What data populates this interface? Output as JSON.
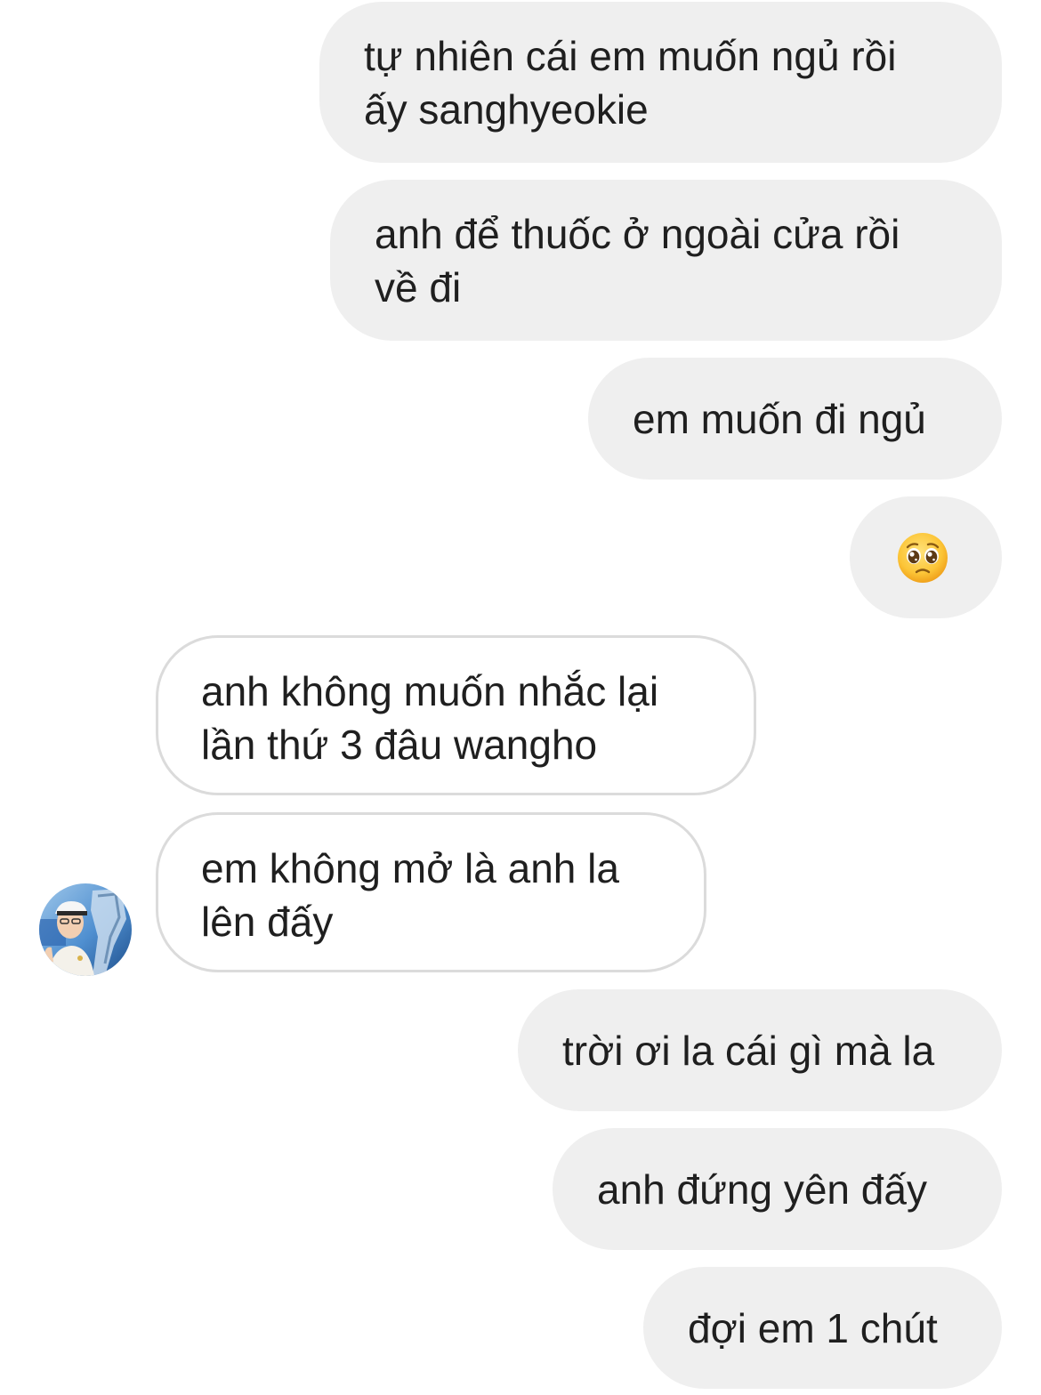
{
  "conversation": {
    "messages": [
      {
        "id": "m1",
        "direction": "sent",
        "text": "tự nhiên cái em muốn ngủ rồi\nấy sanghyeokie"
      },
      {
        "id": "m2",
        "direction": "sent",
        "text": "anh để thuốc ở ngoài cửa rồi\nvề đi"
      },
      {
        "id": "m3",
        "direction": "sent",
        "text": "em muốn đi ngủ"
      },
      {
        "id": "m4",
        "direction": "sent",
        "emoji": "pleading-face-icon"
      },
      {
        "id": "m5",
        "direction": "received",
        "text": "anh không muốn nhắc lại\nlần thứ 3 đâu wangho"
      },
      {
        "id": "m6",
        "direction": "received",
        "text": "em không mở là anh la\nlên đấy"
      },
      {
        "id": "m7",
        "direction": "sent",
        "text": "trời ơi la cái gì mà la"
      },
      {
        "id": "m8",
        "direction": "sent",
        "text": "anh đứng yên đấy"
      },
      {
        "id": "m9",
        "direction": "sent",
        "text": "đợi em 1 chút"
      }
    ],
    "avatar_icon": "contact-avatar-photo"
  },
  "colors": {
    "sent_bubble": "#efefef",
    "received_border": "#dbdbdb",
    "text": "#1f1f1f",
    "background": "#ffffff"
  }
}
